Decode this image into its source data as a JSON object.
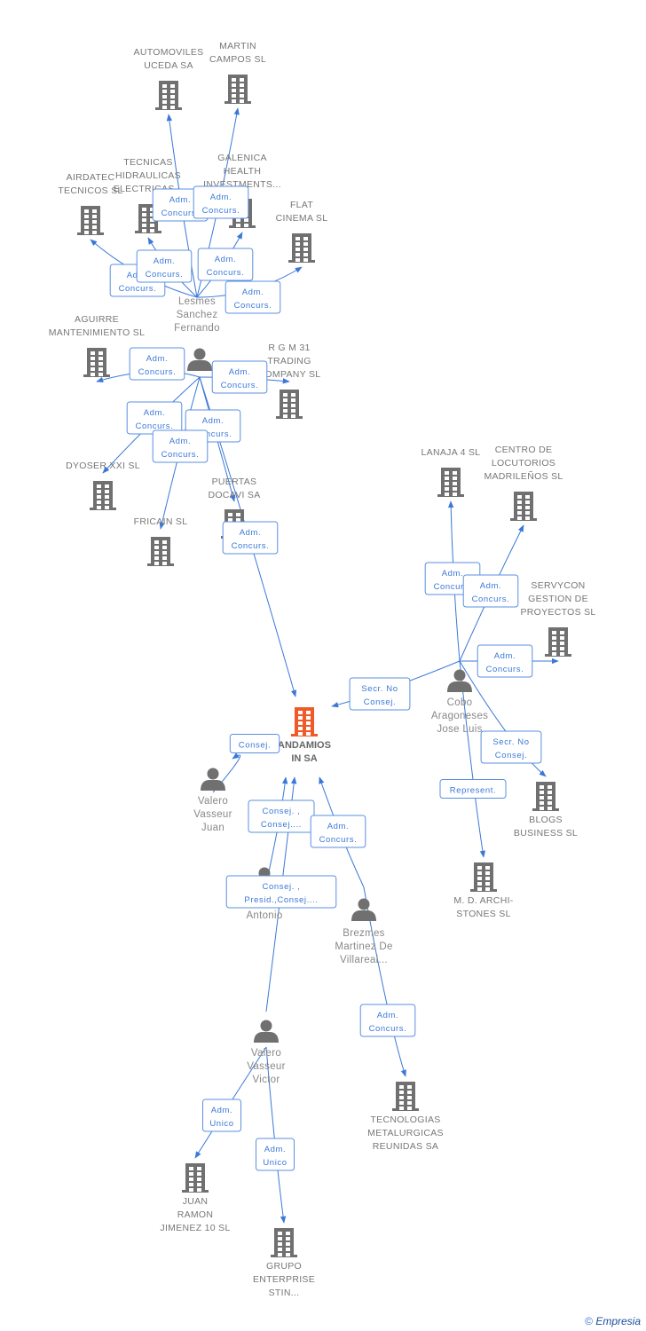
{
  "colors": {
    "edge": "#3a78d8",
    "node": "#707070",
    "center": "#f05a28"
  },
  "nodes": [
    {
      "id": "center",
      "type": "company-main",
      "name": [
        "ANDAMIOS",
        "IN SA"
      ]
    },
    {
      "id": "automoviles",
      "type": "company",
      "name": [
        "AUTOMOVILES",
        "UCEDA SA"
      ]
    },
    {
      "id": "martin",
      "type": "company",
      "name": [
        "MARTIN",
        "CAMPOS SL"
      ]
    },
    {
      "id": "airdatec",
      "type": "company",
      "name": [
        "AIRDATEC",
        "TECNICOS SL"
      ]
    },
    {
      "id": "tecnicas",
      "type": "company",
      "name": [
        "TECNICAS",
        "HIDRAULICAS",
        "ELECTRICAS..."
      ]
    },
    {
      "id": "galenica",
      "type": "company",
      "name": [
        "GALENICA",
        "HEALTH",
        "INVESTMENTS..."
      ]
    },
    {
      "id": "flat",
      "type": "company",
      "name": [
        "FLAT",
        "CINEMA SL"
      ]
    },
    {
      "id": "lesmes",
      "type": "person-hidden",
      "name": [
        "Lesmes",
        "Sanchez",
        "Fernando"
      ]
    },
    {
      "id": "p2",
      "type": "person",
      "name": []
    },
    {
      "id": "aguirre",
      "type": "company",
      "name": [
        "AGUIRRE",
        "MANTENIMIENTO SL"
      ]
    },
    {
      "id": "rgm",
      "type": "company",
      "name": [
        "R G M 31",
        "TRADING",
        "COMPANY SL"
      ]
    },
    {
      "id": "dyoser",
      "type": "company",
      "name": [
        "DYOSER XXI SL"
      ]
    },
    {
      "id": "fricain",
      "type": "company",
      "name": [
        "FRICAIN SL"
      ]
    },
    {
      "id": "puertas",
      "type": "company",
      "name": [
        "PUERTAS",
        "DOCAVI SA"
      ]
    },
    {
      "id": "lanaja",
      "type": "company",
      "name": [
        "LANAJA 4 SL"
      ]
    },
    {
      "id": "centro",
      "type": "company",
      "name": [
        "CENTRO DE",
        "LOCUTORIOS",
        "MADRILEÑOS SL"
      ]
    },
    {
      "id": "servycon",
      "type": "company",
      "name": [
        "SERVYCON",
        "GESTION DE",
        "PROYECTOS SL"
      ]
    },
    {
      "id": "cobo",
      "type": "person",
      "name": [
        "Cobo",
        "Aragoneses",
        "Jose Luis"
      ]
    },
    {
      "id": "blogs",
      "type": "company",
      "name": [
        "BLOGS",
        "BUSINESS SL"
      ]
    },
    {
      "id": "mdarch",
      "type": "company",
      "name": [
        "M. D. ARCHI-",
        "STONES SL"
      ]
    },
    {
      "id": "vjuan",
      "type": "person",
      "name": [
        "Valero",
        "Vasseur",
        "Juan"
      ]
    },
    {
      "id": "parra",
      "type": "person",
      "name": [
        "",
        "La Parra",
        "Antonio"
      ]
    },
    {
      "id": "brezmes",
      "type": "person",
      "name": [
        "Brezmes",
        "Martinez De",
        "Villareal..."
      ]
    },
    {
      "id": "tecnologias",
      "type": "company",
      "name": [
        "TECNOLOGIAS",
        "METALURGICAS",
        "REUNIDAS SA"
      ]
    },
    {
      "id": "vvictor",
      "type": "person",
      "name": [
        "Valero",
        "Vasseur",
        "Victor"
      ]
    },
    {
      "id": "juanramon",
      "type": "company",
      "name": [
        "JUAN",
        "RAMON",
        "JIMENEZ 10 SL"
      ]
    },
    {
      "id": "grupo",
      "type": "company",
      "name": [
        "GRUPO",
        "ENTERPRISE",
        "STIN..."
      ]
    }
  ],
  "edges": [
    {
      "from": "lesmes",
      "to": "automoviles",
      "label": [
        "Adm.",
        "Concurs."
      ]
    },
    {
      "from": "lesmes",
      "to": "martin",
      "label": [
        "Adm.",
        "Concurs."
      ]
    },
    {
      "from": "lesmes",
      "to": "airdatec",
      "label": [
        "Adm.",
        "Concurs."
      ]
    },
    {
      "from": "lesmes",
      "to": "tecnicas",
      "label": [
        "Adm.",
        "Concurs."
      ]
    },
    {
      "from": "lesmes",
      "to": "galenica",
      "label": [
        "Adm.",
        "Concurs."
      ]
    },
    {
      "from": "lesmes",
      "to": "flat",
      "label": [
        "Adm.",
        "Concurs."
      ]
    },
    {
      "from": "p2",
      "to": "aguirre",
      "label": [
        "Adm.",
        "Concurs."
      ]
    },
    {
      "from": "p2",
      "to": "rgm",
      "label": [
        "Adm.",
        "Concurs."
      ]
    },
    {
      "from": "p2",
      "to": "dyoser",
      "label": [
        "Adm.",
        "Concurs."
      ]
    },
    {
      "from": "p2",
      "to": "puertas",
      "label": [
        "Adm.",
        "Concurs."
      ]
    },
    {
      "from": "p2",
      "to": "fricain",
      "label": [
        "Adm.",
        "Concurs."
      ]
    },
    {
      "from": "p2",
      "to": "center",
      "label": [
        "Adm.",
        "Concurs."
      ]
    },
    {
      "from": "cobo",
      "to": "lanaja",
      "label": [
        "Adm.",
        "Concurs."
      ]
    },
    {
      "from": "cobo",
      "to": "centro",
      "label": [
        "Adm.",
        "Concurs."
      ]
    },
    {
      "from": "cobo",
      "to": "servycon",
      "label": [
        "Adm.",
        "Concurs."
      ]
    },
    {
      "from": "cobo",
      "to": "center",
      "label": [
        "Secr.  No",
        "Consej."
      ]
    },
    {
      "from": "cobo",
      "to": "blogs",
      "label": [
        "Secr.  No",
        "Consej."
      ]
    },
    {
      "from": "cobo",
      "to": "mdarch",
      "label": [
        "Represent."
      ]
    },
    {
      "from": "vjuan",
      "to": "center",
      "label": [
        "Consej."
      ]
    },
    {
      "from": "parra",
      "to": "center",
      "label": [
        "Consej. ,",
        "Consej...."
      ]
    },
    {
      "from": "vvictor",
      "to": "center",
      "label": [
        "Consej. ,",
        "Presid.,Consej...."
      ]
    },
    {
      "from": "brezmes",
      "to": "center",
      "label": [
        "Adm.",
        "Concurs."
      ]
    },
    {
      "from": "brezmes",
      "to": "tecnologias",
      "label": [
        "Adm.",
        "Concurs."
      ]
    },
    {
      "from": "vvictor",
      "to": "juanramon",
      "label": [
        "Adm.",
        "Unico"
      ]
    },
    {
      "from": "vvictor",
      "to": "grupo",
      "label": [
        "Adm.",
        "Unico"
      ]
    }
  ],
  "footer": {
    "copyright": "©",
    "brand": "Empresia"
  }
}
